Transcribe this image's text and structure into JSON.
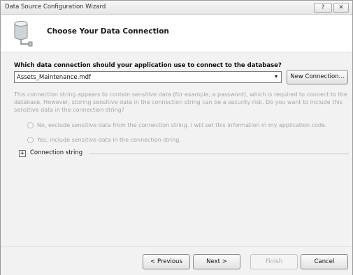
{
  "window": {
    "title": "Data Source Configuration Wizard",
    "help_label": "?",
    "close_label": "✕"
  },
  "header": {
    "heading": "Choose Your Data Connection",
    "icon": "database-icon"
  },
  "connection": {
    "question": "Which data connection should your application use to connect to the database?",
    "selected": "Assets_Maintenance.mdf",
    "arrow": "▾",
    "new_connection_label": "New Connection..."
  },
  "sensitive": {
    "info": "This connection string appears to contain sensitive data (for example, a password), which is required to connect to the database. However, storing sensitive data in the connection string can be a security risk. Do you want to include this sensitive data in the connection string?",
    "option_exclude": "No, exclude sensitive data from the connection string. I will set this information in my application code.",
    "option_include": "Yes, include sensitive data in the connection string."
  },
  "connection_string": {
    "toggle": "+",
    "label": "Connection string"
  },
  "footer": {
    "previous_label": "< Previous",
    "next_label": "Next >",
    "finish_label": "Finish",
    "cancel_label": "Cancel"
  },
  "colors": {
    "dialog_bg": "#f2f2f2",
    "header_bg": "#ffffff",
    "disabled_text": "#a6a6a6"
  }
}
